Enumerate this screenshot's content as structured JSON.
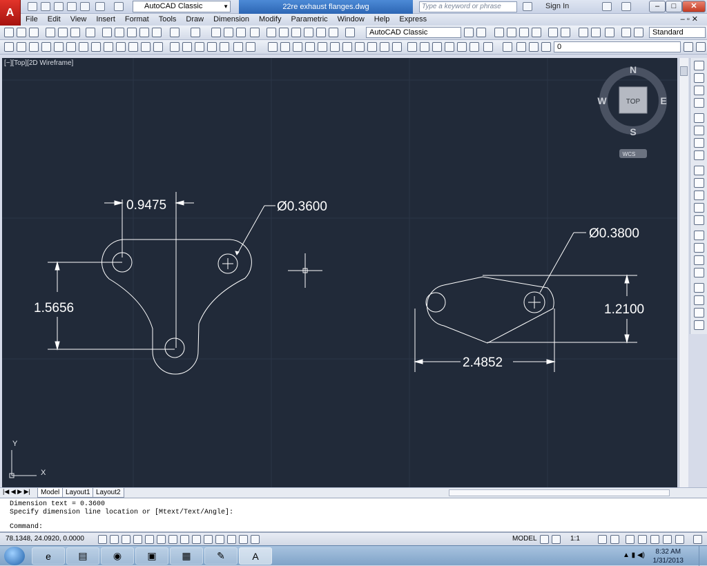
{
  "window": {
    "document_title": "22re exhaust flanges.dwg",
    "workspace": "AutoCAD Classic",
    "search_placeholder": "Type a keyword or phrase",
    "sign_in": "Sign In"
  },
  "menu": [
    "File",
    "Edit",
    "View",
    "Insert",
    "Format",
    "Tools",
    "Draw",
    "Dimension",
    "Modify",
    "Parametric",
    "Window",
    "Help",
    "Express"
  ],
  "toolbar": {
    "workspace_combo": "AutoCAD Classic",
    "text_style": "Standard",
    "layer": "0"
  },
  "viewport": {
    "label": "[−][Top][2D Wireframe]",
    "viewcube": {
      "face": "TOP",
      "n": "N",
      "s": "S",
      "e": "E",
      "w": "W",
      "wcs": "WCS"
    },
    "ucs": {
      "y": "Y",
      "x": "X"
    }
  },
  "drawing": {
    "dim_width_left": "0.9475",
    "dia_left": "Ø0.3600",
    "dim_height_left": "1.5656",
    "dia_right": "Ø0.3800",
    "dim_height_right": "1.2100",
    "dim_width_right": "2.4852"
  },
  "layout_tabs": [
    "Model",
    "Layout1",
    "Layout2"
  ],
  "command_line": {
    "line1": "Dimension text = 0.3600",
    "line2": "Specify dimension line location or [Mtext/Text/Angle]:",
    "prompt": "Command:"
  },
  "status": {
    "coords": "78.1348, 24.0920, 0.0000",
    "model": "MODEL",
    "scale": "1:1"
  },
  "taskbar": {
    "time": "8:32 AM",
    "date": "1/31/2013"
  },
  "colors": {
    "canvas": "#212a39",
    "grid": "#2b3446",
    "geometry": "#ffffff",
    "title_tab": "#2d66b4"
  }
}
